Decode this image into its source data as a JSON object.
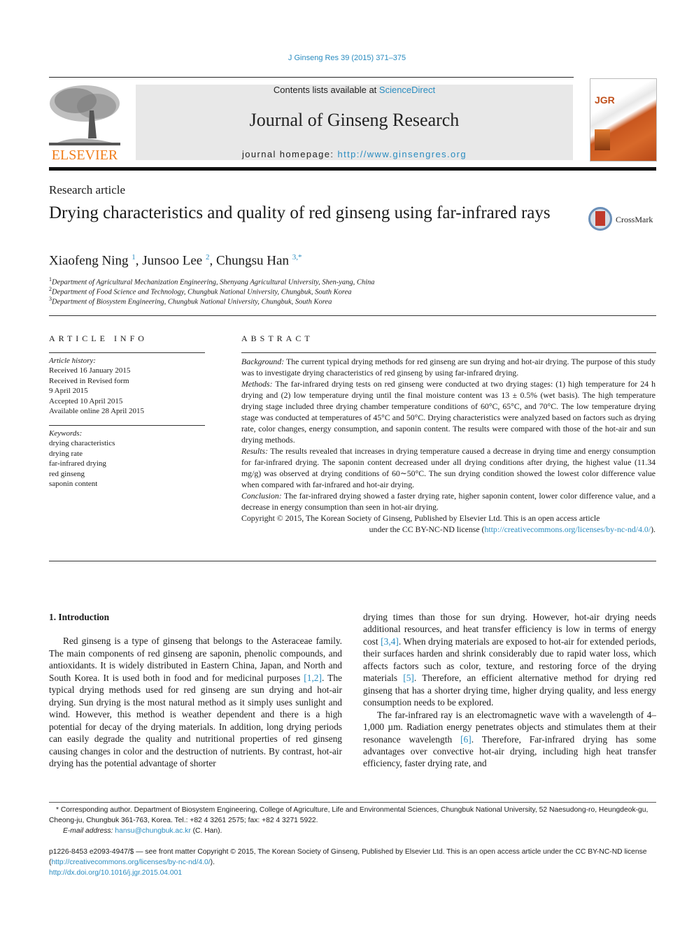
{
  "header": {
    "citation": "J Ginseng Res 39 (2015) 371–375",
    "contents_prefix": "Contents lists available at ",
    "contents_link": "ScienceDirect",
    "journal_title": "Journal of Ginseng Research",
    "homepage_prefix": "journal homepage: ",
    "homepage_url": "http://www.ginsengres.org",
    "publisher_logo": "ELSEVIER",
    "cover_label": "JGR",
    "crossmark_label": "CrossMark"
  },
  "article": {
    "type": "Research article",
    "title": "Drying characteristics and quality of red ginseng using far-infrared rays",
    "authors": [
      {
        "name": "Xiaofeng Ning",
        "sup": "1"
      },
      {
        "name": "Junsoo Lee",
        "sup": "2"
      },
      {
        "name": "Chungsu Han",
        "sup": "3,*"
      }
    ],
    "affiliations": [
      {
        "sup": "1",
        "text": "Department of Agricultural Mechanization Engineering, Shenyang Agricultural University, Shen-yang, China"
      },
      {
        "sup": "2",
        "text": "Department of Food Science and Technology, Chungbuk National University, Chungbuk, South Korea"
      },
      {
        "sup": "3",
        "text": "Department of Biosystem Engineering, Chungbuk National University, Chungbuk, South Korea"
      }
    ]
  },
  "article_info": {
    "heading": "ARTICLE INFO",
    "history_label": "Article history:",
    "history": [
      "Received 16 January 2015",
      "Received in Revised form",
      "9 April 2015",
      "Accepted 10 April 2015",
      "Available online 28 April 2015"
    ],
    "keywords_label": "Keywords:",
    "keywords": [
      "drying characteristics",
      "drying rate",
      "far-infrared drying",
      "red ginseng",
      "saponin content"
    ]
  },
  "abstract": {
    "heading": "ABSTRACT",
    "sections": [
      {
        "label": "Background:",
        "text": " The current typical drying methods for red ginseng are sun drying and hot-air drying. The purpose of this study was to investigate drying characteristics of red ginseng by using far-infrared drying."
      },
      {
        "label": "Methods:",
        "text": " The far-infrared drying tests on red ginseng were conducted at two drying stages: (1) high temperature for 24 h drying and (2) low temperature drying until the final moisture content was 13 ± 0.5% (wet basis). The high temperature drying stage included three drying chamber temperature conditions of 60°C, 65°C, and 70°C. The low temperature drying stage was conducted at temperatures of 45°C and 50°C. Drying characteristics were analyzed based on factors such as drying rate, color changes, energy consumption, and saponin content. The results were compared with those of the hot-air and sun drying methods."
      },
      {
        "label": "Results:",
        "text": " The results revealed that increases in drying temperature caused a decrease in drying time and energy consumption for far-infrared drying. The saponin content decreased under all drying conditions after drying, the highest value (11.34 mg/g) was observed at drying conditions of 60∼50°C. The sun drying condition showed the lowest color difference value when compared with far-infrared and hot-air drying."
      },
      {
        "label": "Conclusion:",
        "text": " The far-infrared drying showed a faster drying rate, higher saponin content, lower color difference value, and a decrease in energy consumption than seen in hot-air drying."
      }
    ],
    "copyright_line1": "Copyright © 2015, The Korean Society of Ginseng, Published by Elsevier Ltd. This is an open access article",
    "copyright_line2_prefix": "under the CC BY-NC-ND license (",
    "copyright_link": "http://creativecommons.org/licenses/by-nc-nd/4.0/",
    "copyright_line2_suffix": ")."
  },
  "introduction": {
    "heading": "1.  Introduction",
    "p1_a": "Red ginseng is a type of ginseng that belongs to the Asteraceae family. The main components of red ginseng are saponin, phenolic compounds, and antioxidants. It is widely distributed in Eastern China, Japan, and North and South Korea. It is used both in food and for medicinal purposes ",
    "p1_ref1": "[1,2]",
    "p1_b": ". The typical drying methods used for red ginseng are sun drying and hot-air drying. Sun drying is the most natural method as it simply uses sunlight and wind. However, this method is weather dependent and there is a high potential for decay of the drying materials. In addition, long drying periods can easily degrade the quality and nutritional properties of red ginseng causing changes in color and the destruction of nutrients. By contrast, hot-air drying has the potential advantage of shorter",
    "p1_c": "drying times than those for sun drying. However, hot-air drying needs additional resources, and heat transfer efficiency is low in terms of energy cost ",
    "p1_ref2": "[3,4]",
    "p1_d": ". When drying materials are exposed to hot-air for extended periods, their surfaces harden and shrink considerably due to rapid water loss, which affects factors such as color, texture, and restoring force of the drying materials ",
    "p1_ref3": "[5]",
    "p1_e": ". Therefore, an efficient alternative method for drying red ginseng that has a shorter drying time, higher drying quality, and less energy consumption needs to be explored.",
    "p2_a": "The far-infrared ray is an electromagnetic wave with a wavelength of 4–1,000 µm. Radiation energy penetrates objects and stimulates them at their resonance wavelength ",
    "p2_ref": "[6]",
    "p2_b": ". Therefore, Far-infrared drying has some advantages over convective hot-air drying, including high heat transfer efficiency, faster drying rate, and"
  },
  "footnotes": {
    "corresponding": "* Corresponding author. Department of Biosystem Engineering, College of Agriculture, Life and Environmental Sciences, Chungbuk National University, 52 Naesudong-ro, Heungdeok-gu, Cheong-ju, Chungbuk 361-763, Korea. Tel.: +82 4 3261 2575; fax: +82 4 3271 5922.",
    "email_label": "E-mail address: ",
    "email": "hansu@chungbuk.ac.kr",
    "email_suffix": " (C. Han).",
    "issn_text": "p1226-8453  e2093-4947/$ — see front matter Copyright © 2015, The Korean Society of Ginseng, Published by Elsevier Ltd. This is an open access article under the CC BY-NC-ND license (",
    "license_link": "http://creativecommons.org/licenses/by-nc-nd/4.0/",
    "license_suffix": ").",
    "doi": "http://dx.doi.org/10.1016/j.jgr.2015.04.001"
  }
}
